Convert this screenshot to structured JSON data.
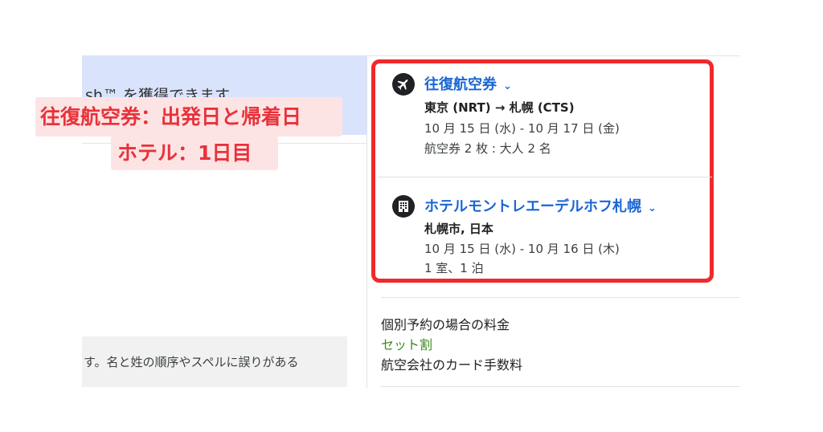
{
  "left": {
    "banner_text": "sh™ を獲得できます",
    "notice_text": "す。名と姓の順序やスペルに誤りがある"
  },
  "caption": {
    "line1": "往復航空券：出発日と帰着日",
    "line2": "ホテル：1日目"
  },
  "flight": {
    "title": "往復航空券",
    "route": "東京 (NRT) → 札幌 (CTS)",
    "dates": "10 月 15 日 (水) - 10 月 17 日 (金)",
    "tickets": "航空券 2 枚 : 大人 2 名",
    "icon": "airplane-icon"
  },
  "hotel": {
    "title": "ホテルモントレエーデルホフ札幌",
    "location": "札幌市, 日本",
    "dates": "10 月 15 日 (水) - 10 月 16 日 (木)",
    "rooms": "1 室、1 泊",
    "icon": "hotel-building-icon"
  },
  "pricing": {
    "separate_label": "個別予約の場合の料金",
    "bundle_label": "セット割",
    "card_fee_label": "航空会社のカード手数料"
  },
  "colors": {
    "link_blue": "#1a66d2",
    "highlight_red": "#ef2a2a",
    "discount_green": "#3d8a20"
  }
}
